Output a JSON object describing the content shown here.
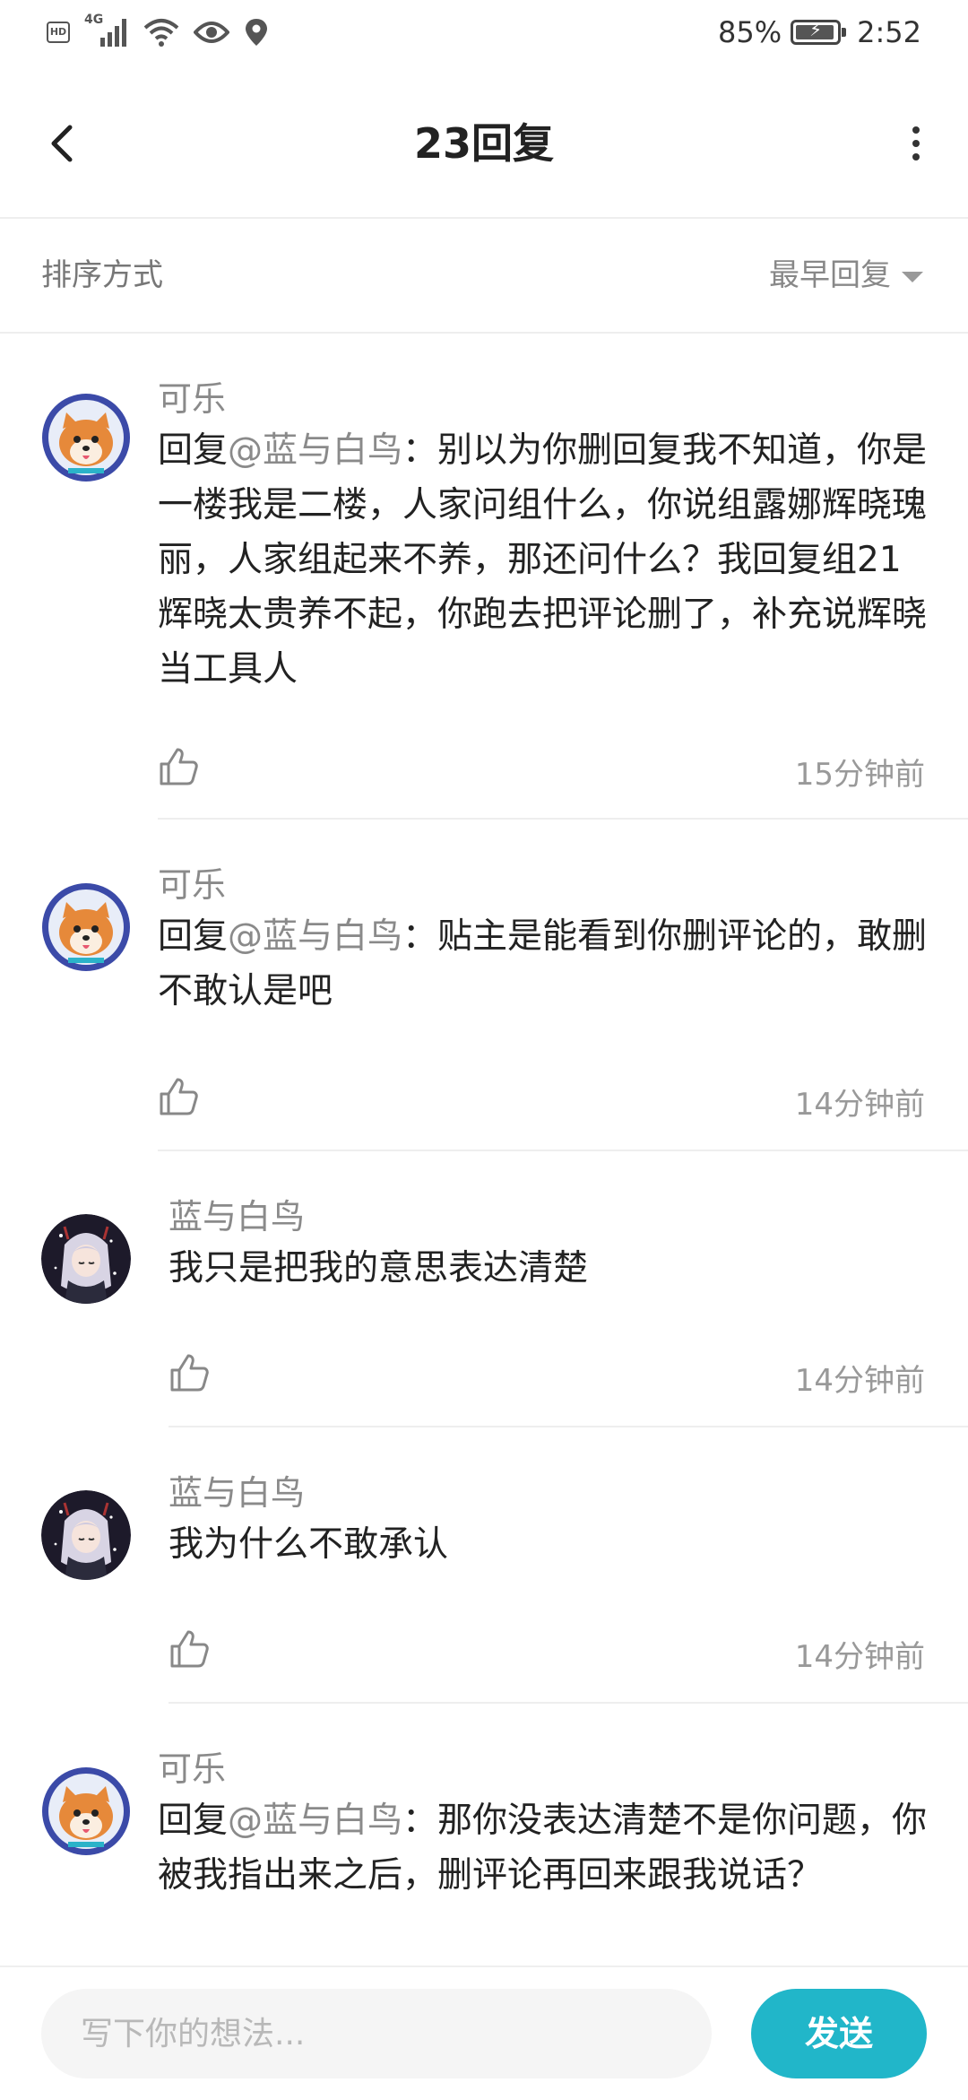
{
  "status_bar": {
    "left_icons": [
      "hd-icon",
      "4g-signal-icon",
      "wifi-icon",
      "eye-icon",
      "location-icon"
    ],
    "network_label": "4G",
    "hd_label": "HD",
    "battery_percent": "85%",
    "battery_level": 0.85,
    "time": "2:52"
  },
  "header": {
    "title": "23回复"
  },
  "sort": {
    "label": "排序方式",
    "value": "最早回复"
  },
  "replies": [
    {
      "user": "可乐",
      "reply_prefix": "回复",
      "mention": "@蓝与白鸟",
      "text": "：别以为你删回复我不知道，你是一楼我是二楼，人家问组什么，你说组露娜辉晓瑰丽，人家组起来不养，那还问什么？我回复组21辉晓太贵养不起，你跑去把评论删了，补充说辉晓当工具人",
      "time": "15分钟前"
    },
    {
      "user": "可乐",
      "reply_prefix": "回复",
      "mention": "@蓝与白鸟",
      "text": "：贴主是能看到你删评论的，敢删不敢认是吧",
      "time": "14分钟前"
    },
    {
      "user": "蓝与白鸟",
      "text": "我只是把我的意思表达清楚",
      "time": "14分钟前"
    },
    {
      "user": "蓝与白鸟",
      "text": "我为什么不敢承认",
      "time": "14分钟前"
    },
    {
      "user": "可乐",
      "reply_prefix": "回复",
      "mention": "@蓝与白鸟",
      "text": "：那你没表达清楚不是你问题，你被我指出来之后，删评论再回来跟我说话？"
    }
  ],
  "composer": {
    "placeholder": "写下你的想法...",
    "send_label": "发送"
  },
  "colors": {
    "accent": "#21b6c9",
    "muted_text": "#8a8a8a",
    "divider": "#eeeeee"
  }
}
